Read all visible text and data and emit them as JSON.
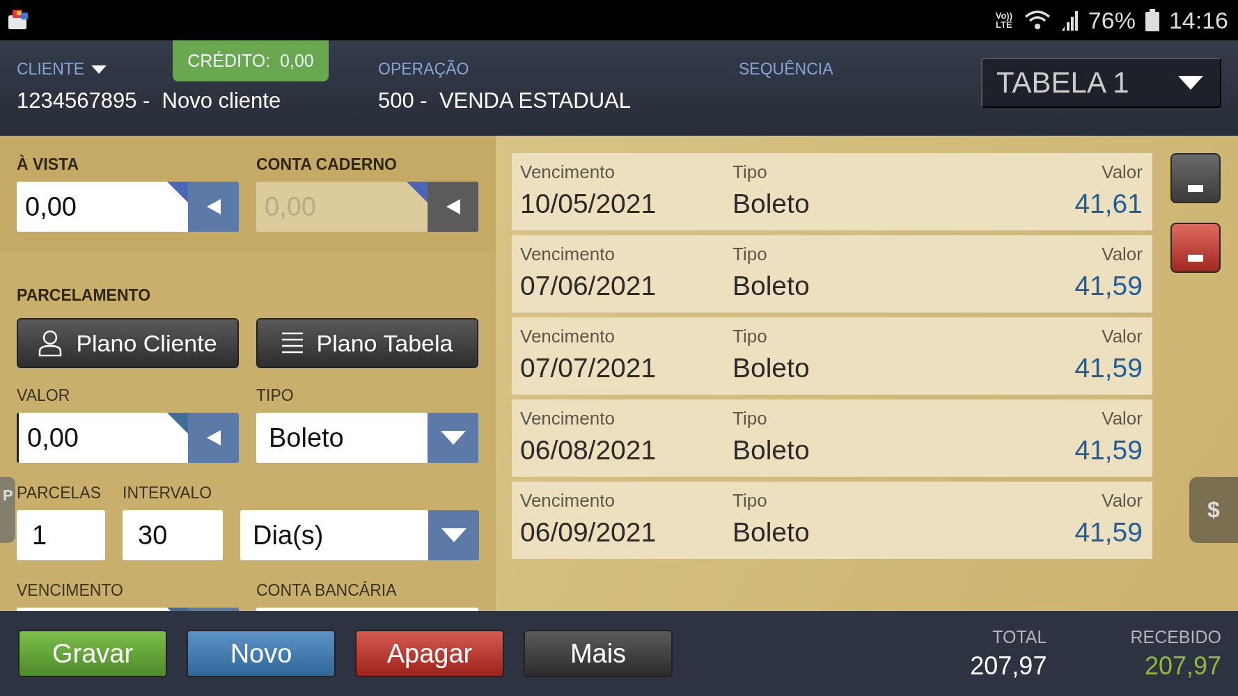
{
  "status_bar": {
    "network": "Vo)) LTE",
    "battery": "76%",
    "time": "14:16"
  },
  "header": {
    "cliente": {
      "label": "CLIENTE",
      "value": "1234567895 -  Novo cliente"
    },
    "credito": "CRÉDITO:  0,00",
    "operacao": {
      "label": "OPERAÇÃO",
      "value": "500 -  VENDA ESTADUAL"
    },
    "sequencia": {
      "label": "SEQUÊNCIA"
    },
    "tabela": "TABELA 1"
  },
  "payment": {
    "fields": [
      {
        "label": "À VISTA",
        "value": "0,00",
        "disabled": false
      },
      {
        "label": "CONTA CADERNO",
        "value": "0,00",
        "disabled": true
      }
    ]
  },
  "parcelamento": {
    "title": "PARCELAMENTO",
    "buttons": [
      {
        "label": "Plano Cliente",
        "kind": "person"
      },
      {
        "label": "Plano Tabela",
        "kind": "list"
      }
    ],
    "rows": [
      [
        {
          "kind": "amount",
          "label": "VALOR",
          "value": "0,00",
          "focused": true
        },
        {
          "kind": "select",
          "label": "TIPO",
          "value": "Boleto",
          "focused": false
        }
      ],
      [
        {
          "kind": "text",
          "label": "PARCELAS",
          "value": "1",
          "focused": false
        },
        {
          "kind": "text",
          "label": "INTERVALO",
          "value": "30",
          "focused": false
        },
        {
          "kind": "select",
          "focused": false,
          "value": "Dia(s)"
        }
      ],
      [
        {
          "kind": "amount",
          "label": "VENCIMENTO",
          "focused": false
        },
        {
          "kind": "plain",
          "label": "CONTA BANCÁRIA",
          "focused": false
        }
      ]
    ]
  },
  "left_handle": "P",
  "installments": [
    {
      "vencimento_label": "Vencimento",
      "date": "10/05/2021",
      "tipo_label": "Tipo",
      "tipo": "Boleto",
      "valor_label": "Valor",
      "valor": "41,61"
    },
    {
      "vencimento_label": "Vencimento",
      "date": "07/06/2021",
      "tipo_label": "Tipo",
      "tipo": "Boleto",
      "valor_label": "Valor",
      "valor": "41,59"
    },
    {
      "vencimento_label": "Vencimento",
      "date": "07/07/2021",
      "tipo_label": "Tipo",
      "tipo": "Boleto",
      "valor_label": "Valor",
      "valor": "41,59"
    },
    {
      "vencimento_label": "Vencimento",
      "date": "06/08/2021",
      "tipo_label": "Tipo",
      "tipo": "Boleto",
      "valor_label": "Valor",
      "valor": "41,59"
    },
    {
      "vencimento_label": "Vencimento",
      "date": "06/09/2021",
      "tipo_label": "Tipo",
      "tipo": "Boleto",
      "valor_label": "Valor",
      "valor": "41,59"
    }
  ],
  "side_buttons": [
    {
      "kind": "neutral"
    },
    {
      "kind": "danger"
    }
  ],
  "right_handle": "$",
  "footer": {
    "buttons": [
      {
        "label": "Gravar",
        "kind": "save"
      },
      {
        "label": "Novo",
        "kind": "new"
      },
      {
        "label": "Apagar",
        "kind": "delete"
      },
      {
        "label": "Mais",
        "kind": "more"
      }
    ],
    "totals": [
      {
        "label": "TOTAL",
        "value": "207,97",
        "kind": "total"
      },
      {
        "label": "RECEBIDO",
        "value": "207,97",
        "kind": "received"
      }
    ]
  }
}
